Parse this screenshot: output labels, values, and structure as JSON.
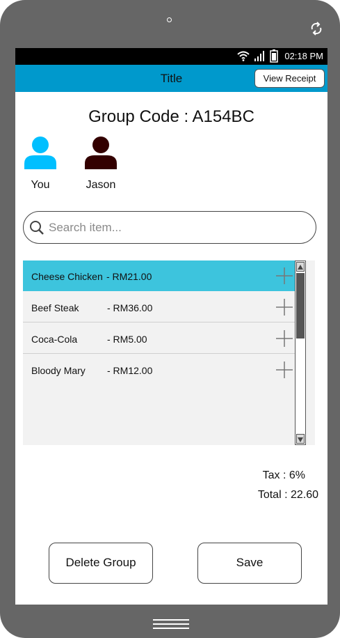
{
  "status_bar": {
    "time": "02:18 PM"
  },
  "title_bar": {
    "title": "Title",
    "view_receipt_label": "View Receipt"
  },
  "group_code_text": "Group Code : A154BC",
  "members": [
    {
      "name": "You",
      "color": "#00bfff"
    },
    {
      "name": "Jason",
      "color": "#330000"
    }
  ],
  "search": {
    "placeholder": "Search item...",
    "value": ""
  },
  "items": [
    {
      "name": "Cheese Chicken",
      "price": "- RM21.00",
      "selected": true
    },
    {
      "name": "Beef Steak",
      "price": "- RM36.00",
      "selected": false
    },
    {
      "name": "Coca-Cola",
      "price": "- RM5.00",
      "selected": false
    },
    {
      "name": "Bloody Mary",
      "price": "- RM12.00",
      "selected": false
    }
  ],
  "summary": {
    "tax": "Tax : 6%",
    "total": "Total : 22.60"
  },
  "buttons": {
    "delete_group": "Delete Group",
    "save": "Save"
  },
  "colors": {
    "accent": "#0099cc",
    "selected_row": "#3dc4dd",
    "list_bg": "#f2f2f2",
    "device_frame": "#666666"
  }
}
